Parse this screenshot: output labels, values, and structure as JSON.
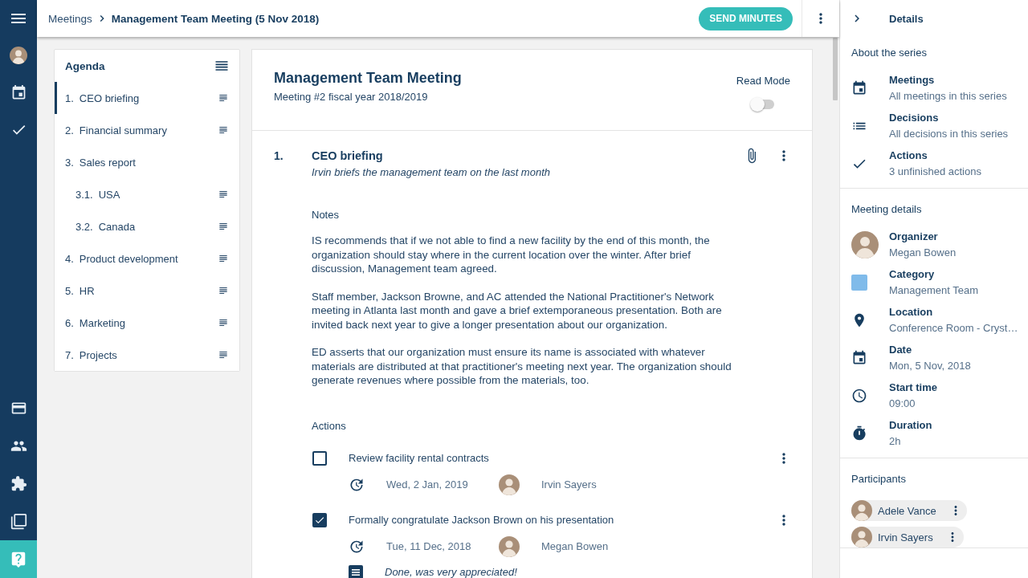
{
  "breadcrumb": {
    "items": [
      {
        "label": "Meetings"
      },
      {
        "label": "Management Team Meeting (5 Nov 2018)"
      }
    ]
  },
  "toolbar": {
    "primary_button": "SEND MINUTES"
  },
  "agenda": {
    "title": "Agenda",
    "items": [
      {
        "number": "1.",
        "title": "CEO briefing",
        "selected": true,
        "has_notes": true
      },
      {
        "number": "2.",
        "title": "Financial summary",
        "selected": false,
        "has_notes": true
      },
      {
        "number": "3.",
        "title": "Sales report",
        "selected": false,
        "has_notes": false,
        "children": [
          {
            "number": "3.1.",
            "title": "USA",
            "selected": false,
            "has_notes": true
          },
          {
            "number": "3.2.",
            "title": "Canada",
            "selected": false,
            "has_notes": true
          }
        ]
      },
      {
        "number": "4.",
        "title": "Product development",
        "selected": false,
        "has_notes": true
      },
      {
        "number": "5.",
        "title": "HR",
        "selected": false,
        "has_notes": true
      },
      {
        "number": "6.",
        "title": "Marketing",
        "selected": false,
        "has_notes": true
      },
      {
        "number": "7.",
        "title": "Projects",
        "selected": false,
        "has_notes": true
      }
    ]
  },
  "meeting": {
    "title": "Management Team Meeting",
    "subtitle": "Meeting #2 fiscal year 2018/2019",
    "read_mode": {
      "label": "Read Mode",
      "on": false
    },
    "topic": {
      "number": "1.",
      "title": "CEO briefing",
      "description": "Irvin briefs the management team on the last month",
      "notes_heading": "Notes",
      "notes": [
        "IS recommends that if we not able to find a new facility by the end of this month, the organization should stay where in the current location over the winter. After brief discussion, Management team agreed.",
        "Staff member, Jackson Browne, and AC attended the National Practitioner's Network meeting in Atlanta last month and gave a brief extemporaneous presentation. Both are invited back next year to give a longer presentation about our organization.",
        "ED asserts that our organization must ensure its name is associated with whatever materials are distributed at that practitioner's meeting next year. The organization should generate revenues where possible from the materials, too."
      ],
      "actions_heading": "Actions",
      "actions": [
        {
          "title": "Review facility rental contracts",
          "checked": false,
          "due": "Wed, 2 Jan, 2019",
          "assignee": "Irvin Sayers"
        },
        {
          "title": "Formally congratulate Jackson Brown on his presentation",
          "checked": true,
          "due": "Tue, 11 Dec, 2018",
          "assignee": "Megan Bowen",
          "comment": "Done, was very appreciated!"
        }
      ]
    }
  },
  "details": {
    "title": "Details",
    "series": {
      "heading": "About the series",
      "items": [
        {
          "kind": "meetings",
          "title": "Meetings",
          "subtitle": "All meetings in this series"
        },
        {
          "kind": "decisions",
          "title": "Decisions",
          "subtitle": "All decisions in this series"
        },
        {
          "kind": "actions",
          "title": "Actions",
          "subtitle": "3 unfinished actions"
        }
      ]
    },
    "meeting_details": {
      "heading": "Meeting details",
      "items": [
        {
          "kind": "person",
          "title": "Organizer",
          "value": "Megan Bowen"
        },
        {
          "kind": "category",
          "title": "Category",
          "value": "Management Team",
          "color": "#80bbea"
        },
        {
          "kind": "location",
          "title": "Location",
          "value": "Conference Room - Cryst…"
        },
        {
          "kind": "date",
          "title": "Date",
          "value": "Mon, 5 Nov, 2018"
        },
        {
          "kind": "time",
          "title": "Start time",
          "value": "09:00"
        },
        {
          "kind": "duration",
          "title": "Duration",
          "value": "2h"
        }
      ]
    },
    "participants": {
      "heading": "Participants",
      "items": [
        {
          "name": "Adele Vance"
        },
        {
          "name": "Irvin Sayers"
        }
      ]
    }
  }
}
